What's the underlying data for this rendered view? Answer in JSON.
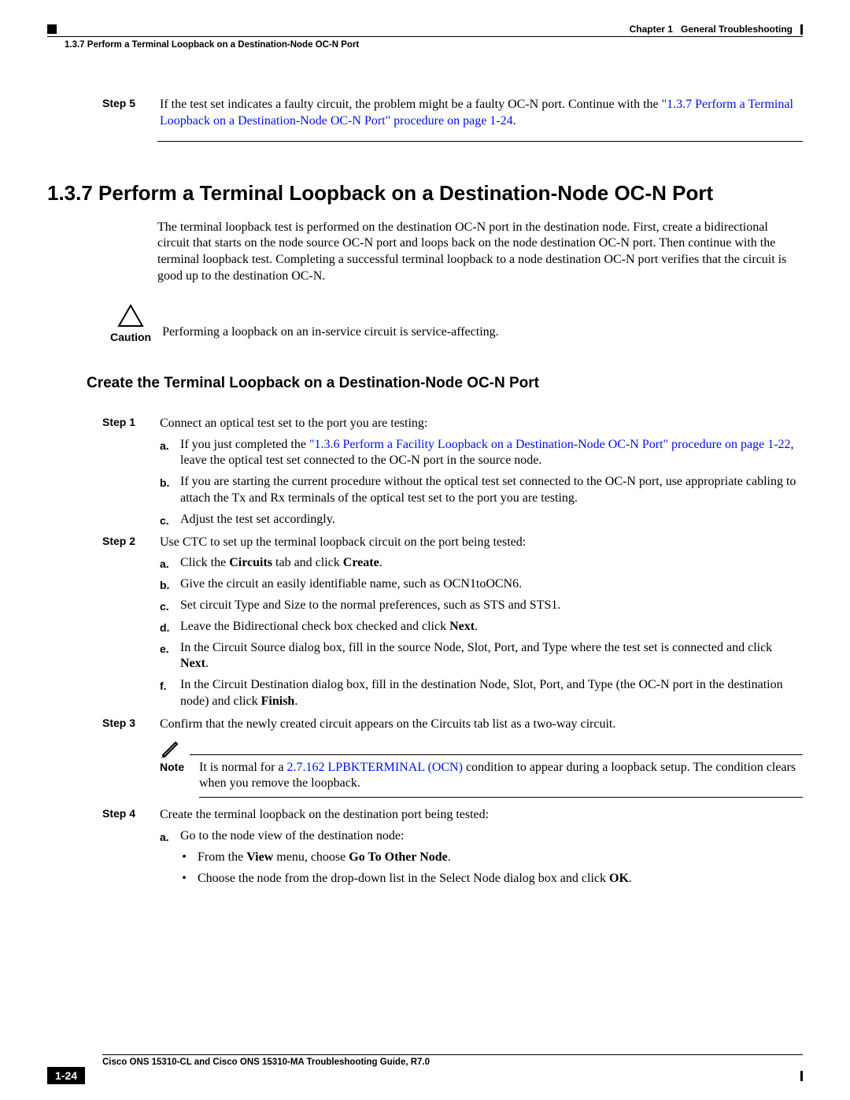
{
  "header": {
    "chapter": "Chapter 1",
    "chapter_title": "General Troubleshooting",
    "breadcrumb": "1.3.7    Perform a Terminal Loopback on a Destination-Node OC-N Port"
  },
  "step5": {
    "label": "Step 5",
    "text_before_link": "If the test set indicates a faulty circuit, the problem might be a faulty OC-N port. Continue with the ",
    "link": "\"1.3.7  Perform a Terminal Loopback on a Destination-Node OC-N Port\" procedure on page 1-24",
    "text_after_link": "."
  },
  "section": {
    "title": "1.3.7  Perform a Terminal Loopback on a Destination-Node OC-N Port",
    "intro": "The terminal loopback test is performed on the destination OC-N port in the destination node. First, create a bidirectional circuit that starts on the node source OC-N port and loops back on the node destination OC-N port. Then continue with the terminal loopback test. Completing a successful terminal loopback to a node destination OC-N port verifies that the circuit is good up to the destination OC-N."
  },
  "caution": {
    "label": "Caution",
    "text": "Performing a loopback on an in-service circuit is service-affecting."
  },
  "subheading": "Create the Terminal Loopback on a Destination-Node OC-N Port",
  "steps": {
    "s1": {
      "label": "Step 1",
      "text": "Connect an optical test set to the port you are testing:",
      "a_prefix": "If you just completed the ",
      "a_link": "\"1.3.6  Perform a Facility Loopback on a Destination-Node OC-N Port\" procedure on page 1-22",
      "a_suffix": ", leave the optical test set connected to the OC-N port in the source node.",
      "b": "If you are starting the current procedure without the optical test set connected to the OC-N port, use appropriate cabling to attach the Tx and Rx terminals of the optical test set to the port you are testing.",
      "c": "Adjust the test set accordingly."
    },
    "s2": {
      "label": "Step 2",
      "text": "Use CTC to set up the terminal loopback circuit on the port being tested:",
      "a_pre": "Click the ",
      "a_b1": "Circuits",
      "a_mid": " tab and click ",
      "a_b2": "Create",
      "a_post": ".",
      "b": "Give the circuit an easily identifiable name, such as OCN1toOCN6.",
      "c": "Set circuit Type and Size to the normal preferences, such as STS and STS1.",
      "d_pre": "Leave the Bidirectional check box checked and click ",
      "d_b": "Next",
      "d_post": ".",
      "e_pre": "In the Circuit Source dialog box, fill in the source Node, Slot, Port, and Type where the test set is connected and click ",
      "e_b": "Next",
      "e_post": ".",
      "f_pre": "In the Circuit Destination dialog box, fill in the destination Node, Slot, Port, and Type (the OC-N port in the destination node) and click ",
      "f_b": "Finish",
      "f_post": "."
    },
    "s3": {
      "label": "Step 3",
      "text": "Confirm that the newly created circuit appears on the Circuits tab list as a two-way circuit.",
      "note_label": "Note",
      "note_pre": "It is normal for a ",
      "note_link": "2.7.162  LPBKTERMINAL (OCN)",
      "note_post": " condition to appear during a loopback setup. The condition clears when you remove the loopback."
    },
    "s4": {
      "label": "Step 4",
      "text": "Create the terminal loopback on the destination port being tested:",
      "a": "Go to the node view of the destination node:",
      "bullet1_pre": "From the ",
      "bullet1_b1": "View",
      "bullet1_mid": " menu, choose ",
      "bullet1_b2": "Go To Other Node",
      "bullet1_post": ".",
      "bullet2_pre": "Choose the node from the drop-down list in the Select Node dialog box and click ",
      "bullet2_b": "OK",
      "bullet2_post": "."
    }
  },
  "footer": {
    "title": "Cisco ONS 15310-CL and Cisco ONS 15310-MA Troubleshooting Guide, R7.0",
    "page": "1-24"
  }
}
